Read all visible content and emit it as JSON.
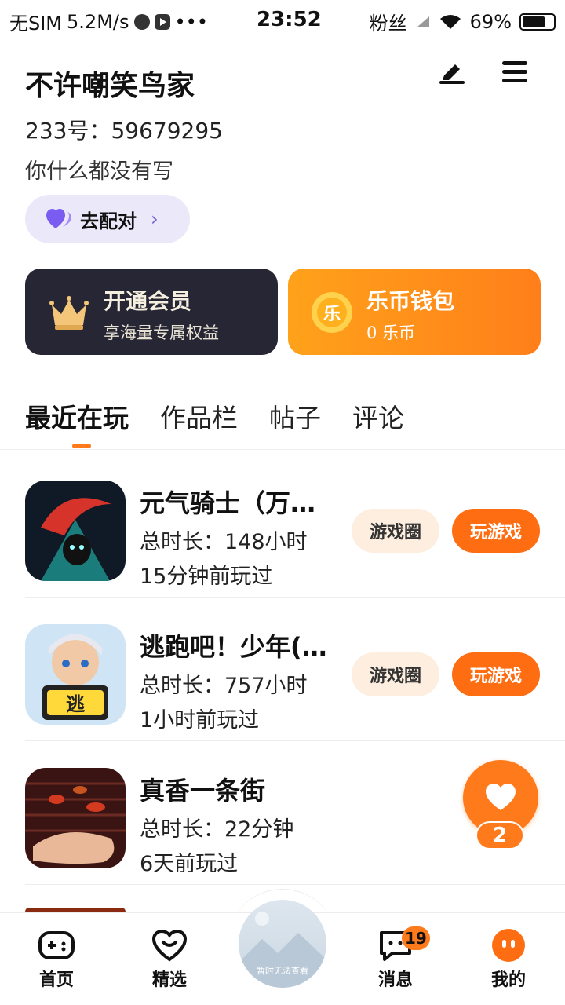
{
  "status_bar": {
    "carrier": "无SIM",
    "speed": "5.2M/s",
    "time": "23:52",
    "fans_label": "粉丝",
    "battery": "69%"
  },
  "profile": {
    "username": "不许嘲笑鸟家",
    "uid": "233号：59679295",
    "bio": "你什么都没有写",
    "match_button": "去配对"
  },
  "cards": {
    "vip": {
      "title": "开通会员",
      "subtitle": "享海量专属权益"
    },
    "coin": {
      "title": "乐币钱包",
      "subtitle": "0 乐币",
      "icon_text": "乐"
    }
  },
  "tabs": [
    "最近在玩",
    "作品栏",
    "帖子",
    "评论"
  ],
  "games": [
    {
      "title": "元气骑士（万…",
      "duration": "总时长：148小时",
      "last_played": "15分钟前玩过",
      "circle_label": "游戏圈",
      "play_label": "玩游戏"
    },
    {
      "title": "逃跑吧！少年(…",
      "duration": "总时长：757小时",
      "last_played": "1小时前玩过",
      "circle_label": "游戏圈",
      "play_label": "玩游戏",
      "icon_text": "逃"
    },
    {
      "title": "真香一条街",
      "duration": "总时长：22分钟",
      "last_played": "6天前玩过"
    }
  ],
  "like_fab": {
    "count": "2"
  },
  "bottom_nav": {
    "items": [
      "首页",
      "精选",
      "消息",
      "我的"
    ],
    "center_label": "暂时无法查看",
    "message_badge": "19"
  },
  "colors": {
    "accent": "#ff7a1a",
    "vip_bg": "#262634",
    "match_bg": "#ebe9f9"
  }
}
